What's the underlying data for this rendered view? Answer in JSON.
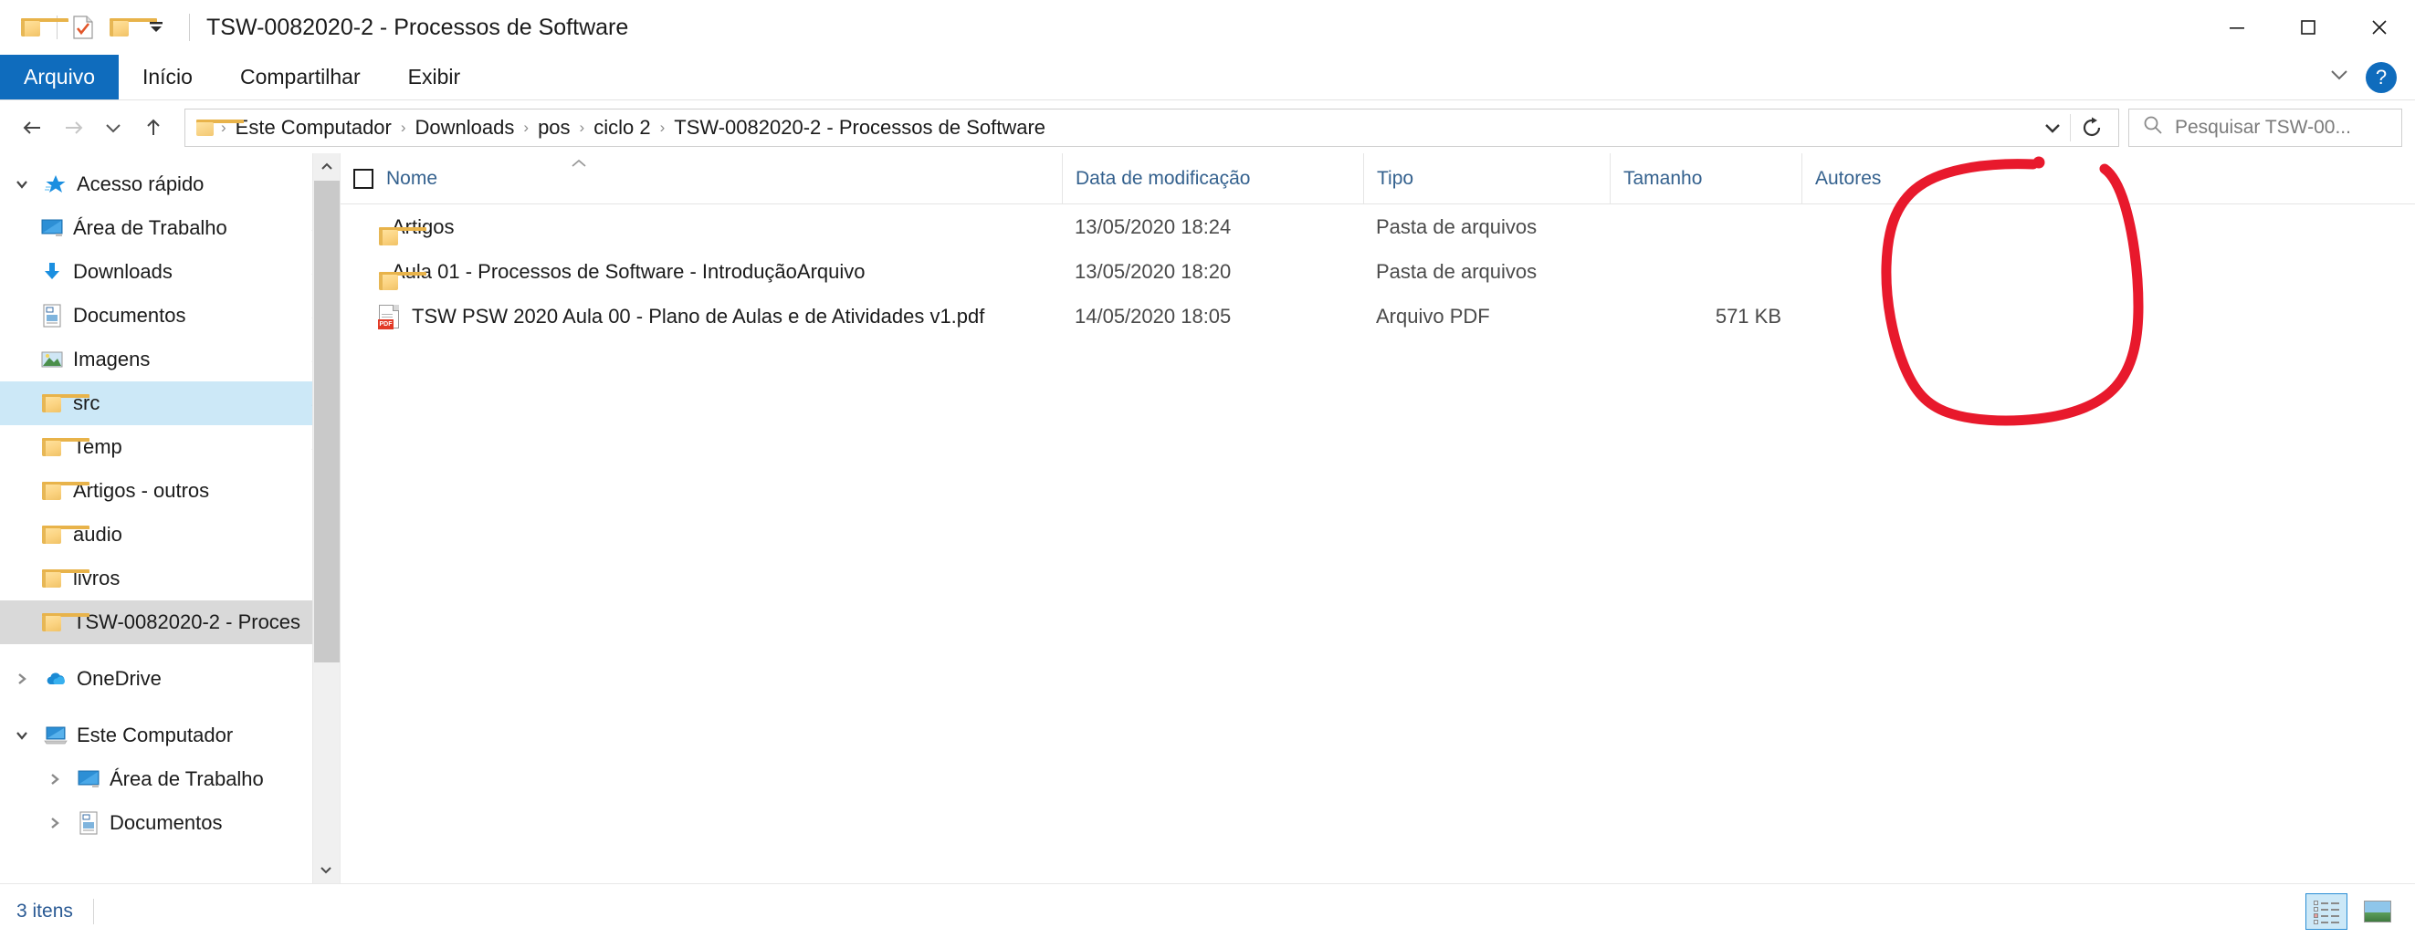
{
  "window": {
    "title": "TSW-0082020-2 - Processos de Software",
    "quick_access": [
      {
        "name": "folder-icon",
        "label": "Propriedades"
      },
      {
        "name": "properties-icon",
        "label": "Propriedades"
      },
      {
        "name": "new-folder-icon",
        "label": "Nova pasta"
      }
    ],
    "controls": {
      "minimize": "—",
      "maximize": "□",
      "close": "✕"
    }
  },
  "ribbon": {
    "tabs": [
      {
        "label": "Arquivo",
        "active": true
      },
      {
        "label": "Início",
        "active": false
      },
      {
        "label": "Compartilhar",
        "active": false
      },
      {
        "label": "Exibir",
        "active": false
      }
    ],
    "collapse_icon": "⌄",
    "help_label": "?"
  },
  "address": {
    "back_icon": "←",
    "forward_icon": "→",
    "recent_icon": "⌄",
    "up_icon": "↑",
    "breadcrumbs": [
      "Este Computador",
      "Downloads",
      "pos",
      "ciclo 2",
      "TSW-0082020-2 - Processos de Software"
    ],
    "separator": "›",
    "dropdown_icon": "⌄",
    "refresh_icon": "↻"
  },
  "search": {
    "placeholder": "Pesquisar TSW-00...",
    "icon": "search-icon"
  },
  "sidebar": {
    "items": [
      {
        "label": "Acesso rápido",
        "icon": "star-icon",
        "indent": 0,
        "expander": "expanded",
        "pinned": false,
        "selected": "none"
      },
      {
        "label": "Área de Trabalho",
        "icon": "desktop-icon",
        "indent": 1,
        "expander": "none",
        "pinned": true,
        "selected": "none"
      },
      {
        "label": "Downloads",
        "icon": "download-icon",
        "indent": 1,
        "expander": "none",
        "pinned": true,
        "selected": "none"
      },
      {
        "label": "Documentos",
        "icon": "document-icon",
        "indent": 1,
        "expander": "none",
        "pinned": true,
        "selected": "none"
      },
      {
        "label": "Imagens",
        "icon": "pictures-icon",
        "indent": 1,
        "expander": "none",
        "pinned": true,
        "selected": "none"
      },
      {
        "label": "src",
        "icon": "folder-icon",
        "indent": 1,
        "expander": "none",
        "pinned": true,
        "selected": "active"
      },
      {
        "label": "Temp",
        "icon": "folder-icon",
        "indent": 1,
        "expander": "none",
        "pinned": true,
        "selected": "none"
      },
      {
        "label": "Artigos - outros",
        "icon": "folder-icon",
        "indent": 1,
        "expander": "none",
        "pinned": false,
        "selected": "none"
      },
      {
        "label": "audio",
        "icon": "folder-icon",
        "indent": 1,
        "expander": "none",
        "pinned": false,
        "selected": "none"
      },
      {
        "label": "livros",
        "icon": "folder-icon",
        "indent": 1,
        "expander": "none",
        "pinned": false,
        "selected": "none"
      },
      {
        "label": "TSW-0082020-2 - Proces",
        "icon": "folder-icon",
        "indent": 1,
        "expander": "none",
        "pinned": false,
        "selected": "inactive"
      },
      {
        "label": "OneDrive",
        "icon": "onedrive-icon",
        "indent": 0,
        "expander": "collapsed",
        "pinned": false,
        "selected": "none"
      },
      {
        "label": "Este Computador",
        "icon": "computer-icon",
        "indent": 0,
        "expander": "expanded",
        "pinned": false,
        "selected": "none"
      },
      {
        "label": "Área de Trabalho",
        "icon": "desktop-icon",
        "indent": 1,
        "expander": "collapsed",
        "pinned": false,
        "selected": "none"
      },
      {
        "label": "Documentos",
        "icon": "document-icon",
        "indent": 1,
        "expander": "collapsed",
        "pinned": false,
        "selected": "none"
      }
    ],
    "scroll_up_icon": "⌃",
    "scroll_down_icon": "⌄"
  },
  "filelist": {
    "columns": [
      {
        "label": "Nome",
        "key": "name"
      },
      {
        "label": "Data de modificação",
        "key": "date"
      },
      {
        "label": "Tipo",
        "key": "type"
      },
      {
        "label": "Tamanho",
        "key": "size"
      },
      {
        "label": "Autores",
        "key": "authors"
      }
    ],
    "sort_indicator": "⌃",
    "rows": [
      {
        "icon": "folder-icon",
        "name": "Artigos",
        "date": "13/05/2020 18:24",
        "type": "Pasta de arquivos",
        "size": "",
        "authors": ""
      },
      {
        "icon": "folder-icon",
        "name": "Aula 01 - Processos de Software - IntroduçãoArquivo",
        "date": "13/05/2020 18:20",
        "type": "Pasta de arquivos",
        "size": "",
        "authors": ""
      },
      {
        "icon": "pdf-icon",
        "name": "TSW PSW 2020 Aula 00 - Plano de Aulas e de Atividades v1.pdf",
        "date": "14/05/2020 18:05",
        "type": "Arquivo PDF",
        "size": "571 KB",
        "authors": ""
      }
    ]
  },
  "statusbar": {
    "item_count": "3 itens",
    "views": [
      {
        "name": "details-view",
        "active": true
      },
      {
        "name": "large-icons-view",
        "active": false
      }
    ]
  },
  "annotation": {
    "shape": "hand-drawn-oval",
    "target": "Autores",
    "color": "#E8192C"
  },
  "colors": {
    "accent": "#0f6cbd",
    "header_text": "#34618e",
    "selection_active": "#cce8f7",
    "selection_inactive": "#d9d9d9",
    "annotation_red": "#E8192C"
  }
}
